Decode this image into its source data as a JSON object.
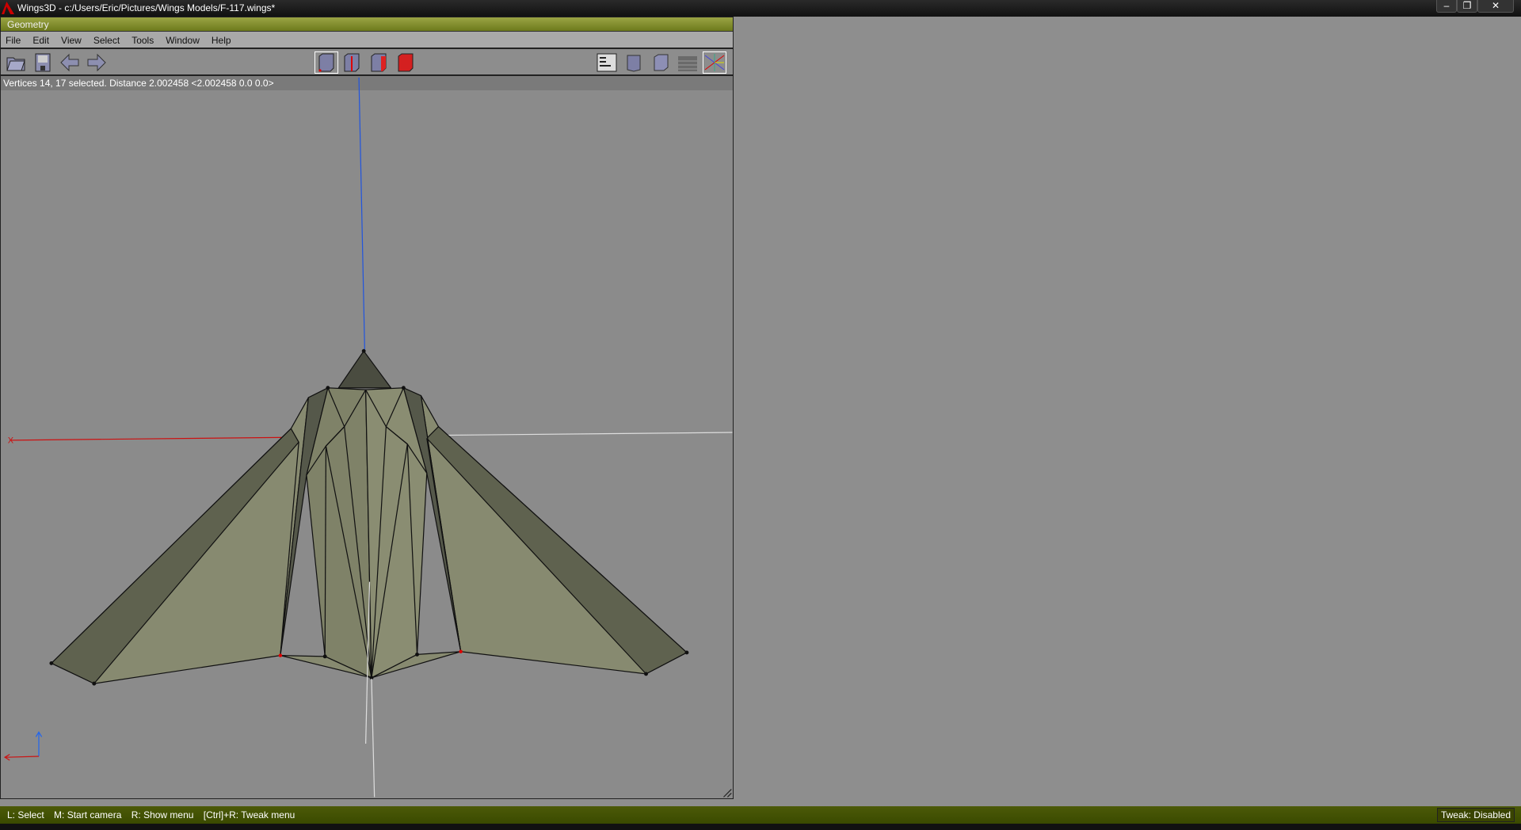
{
  "titlebar": {
    "title": "Wings3D - c:/Users/Eric/Pictures/Wings Models/F-117.wings*",
    "minimize": "–",
    "restore": "❐",
    "close": "✕"
  },
  "geometry": {
    "title": "Geometry",
    "menu": [
      "File",
      "Edit",
      "View",
      "Select",
      "Tools",
      "Window",
      "Help"
    ],
    "info": "Vertices 14, 17 selected. Distance 2.002458  <2.002458  0.0  0.0>",
    "axis_label": "X"
  },
  "statusbar": {
    "hints": [
      "L: Select",
      "M: Start camera",
      "R: Show menu",
      "[Ctrl]+R: Tweak menu"
    ],
    "tweak": "Tweak: Disabled"
  },
  "colors": {
    "accent": "#6d7a1c",
    "model": "#878a70",
    "model_dark": "#55584a"
  }
}
